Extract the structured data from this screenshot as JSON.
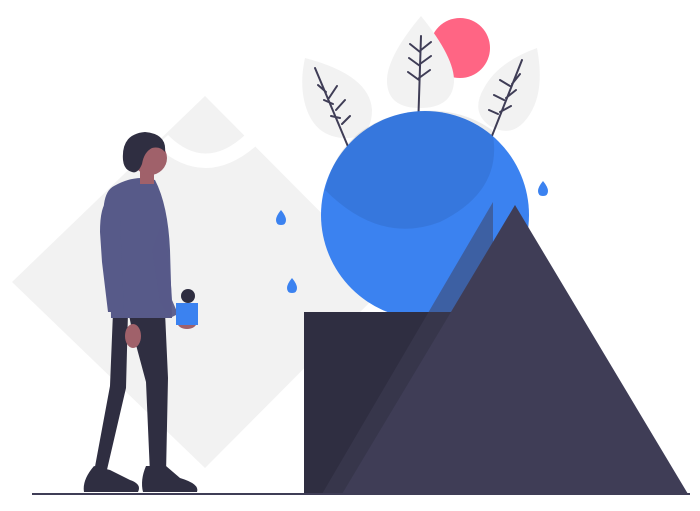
{
  "illustration": {
    "kind": "flat-vector",
    "subject": "person-holding-cube-facing-shapes",
    "colors": {
      "background": "#ffffff",
      "diamond": "#f2f2f2",
      "leaf": "#f2f2f2",
      "leaf_stem": "#3f3d56",
      "sphere": "#3b82f0",
      "sphere_shadow": "#000000",
      "sun": "#ff6584",
      "droplet": "#3b82f0",
      "block": "#2f2e41",
      "triangle": "#3f3d56",
      "ground": "#3f3d56",
      "sweater": "#575a89",
      "pants": "#2f2e41",
      "shoes": "#2f2e41",
      "skin": "#a0616a",
      "hair": "#2f2e41",
      "held_cube": "#3b82f0",
      "held_ball": "#2f2e41"
    },
    "elements": [
      "background-diamond",
      "sun",
      "leaf-left",
      "leaf-middle",
      "leaf-right",
      "blue-sphere",
      "water-droplets",
      "dark-block",
      "triangle-mountain",
      "ground-line",
      "person",
      "held-blue-cube",
      "held-dark-ball"
    ]
  }
}
